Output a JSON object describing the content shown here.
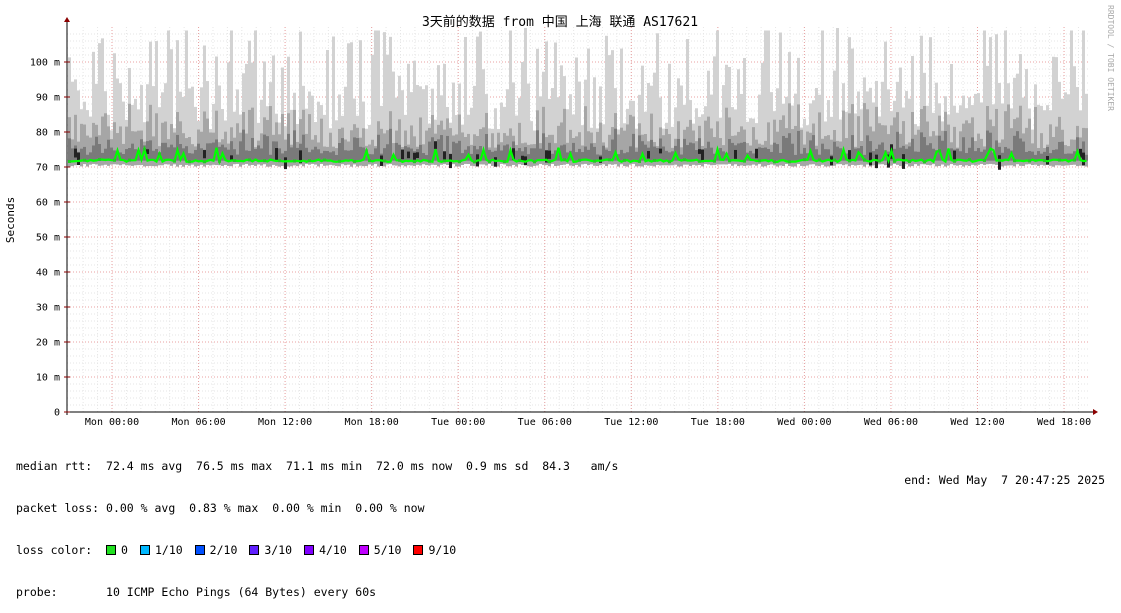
{
  "chart_data": {
    "type": "area",
    "title": "3天前的数据 from 中国 上海 联通 AS17621",
    "ylabel": "Seconds",
    "xlabel": "",
    "watermark": "RRDTOOL / TOBI OETIKER",
    "yticks": [
      "0",
      "10 m",
      "20 m",
      "30 m",
      "40 m",
      "50 m",
      "60 m",
      "70 m",
      "80 m",
      "90 m",
      "100 m"
    ],
    "ylim": [
      0,
      110
    ],
    "xticks": [
      "Mon 00:00",
      "Mon 06:00",
      "Mon 12:00",
      "Mon 18:00",
      "Tue 00:00",
      "Tue 06:00",
      "Tue 12:00",
      "Tue 18:00",
      "Wed 00:00",
      "Wed 06:00",
      "Wed 12:00",
      "Wed 18:00"
    ],
    "grid": true,
    "series": [
      {
        "name": "median rtt",
        "color": "#00ff00",
        "summary": {
          "avg": 72.4,
          "max": 76.5,
          "min": 71.1,
          "now": 72.0,
          "sd": 0.9
        }
      },
      {
        "name": "ping spread",
        "color": "#bbbbbb",
        "range": [
          70,
          100
        ]
      }
    ]
  },
  "stats": {
    "median_label": "median rtt:",
    "median_text": "72.4 ms avg  76.5 ms max  71.1 ms min  72.0 ms now  0.9 ms sd  84.3   am/s",
    "loss_label": "packet loss:",
    "loss_text": "0.00 % avg  0.83 % max  0.00 % min  0.00 % now",
    "color_label": "loss color:",
    "loss_colors": [
      {
        "label": "0",
        "color": "#20e020"
      },
      {
        "label": "1/10",
        "color": "#00b8ff"
      },
      {
        "label": "2/10",
        "color": "#0050ff"
      },
      {
        "label": "3/10",
        "color": "#6020ff"
      },
      {
        "label": "4/10",
        "color": "#8000ff"
      },
      {
        "label": "5/10",
        "color": "#c000ff"
      },
      {
        "label": "9/10",
        "color": "#ff0000"
      }
    ],
    "probe_label": "probe:",
    "probe_text": "10 ICMP Echo Pings (64 Bytes) every 60s",
    "end_text": "end: Wed May  7 20:47:25 2025"
  }
}
